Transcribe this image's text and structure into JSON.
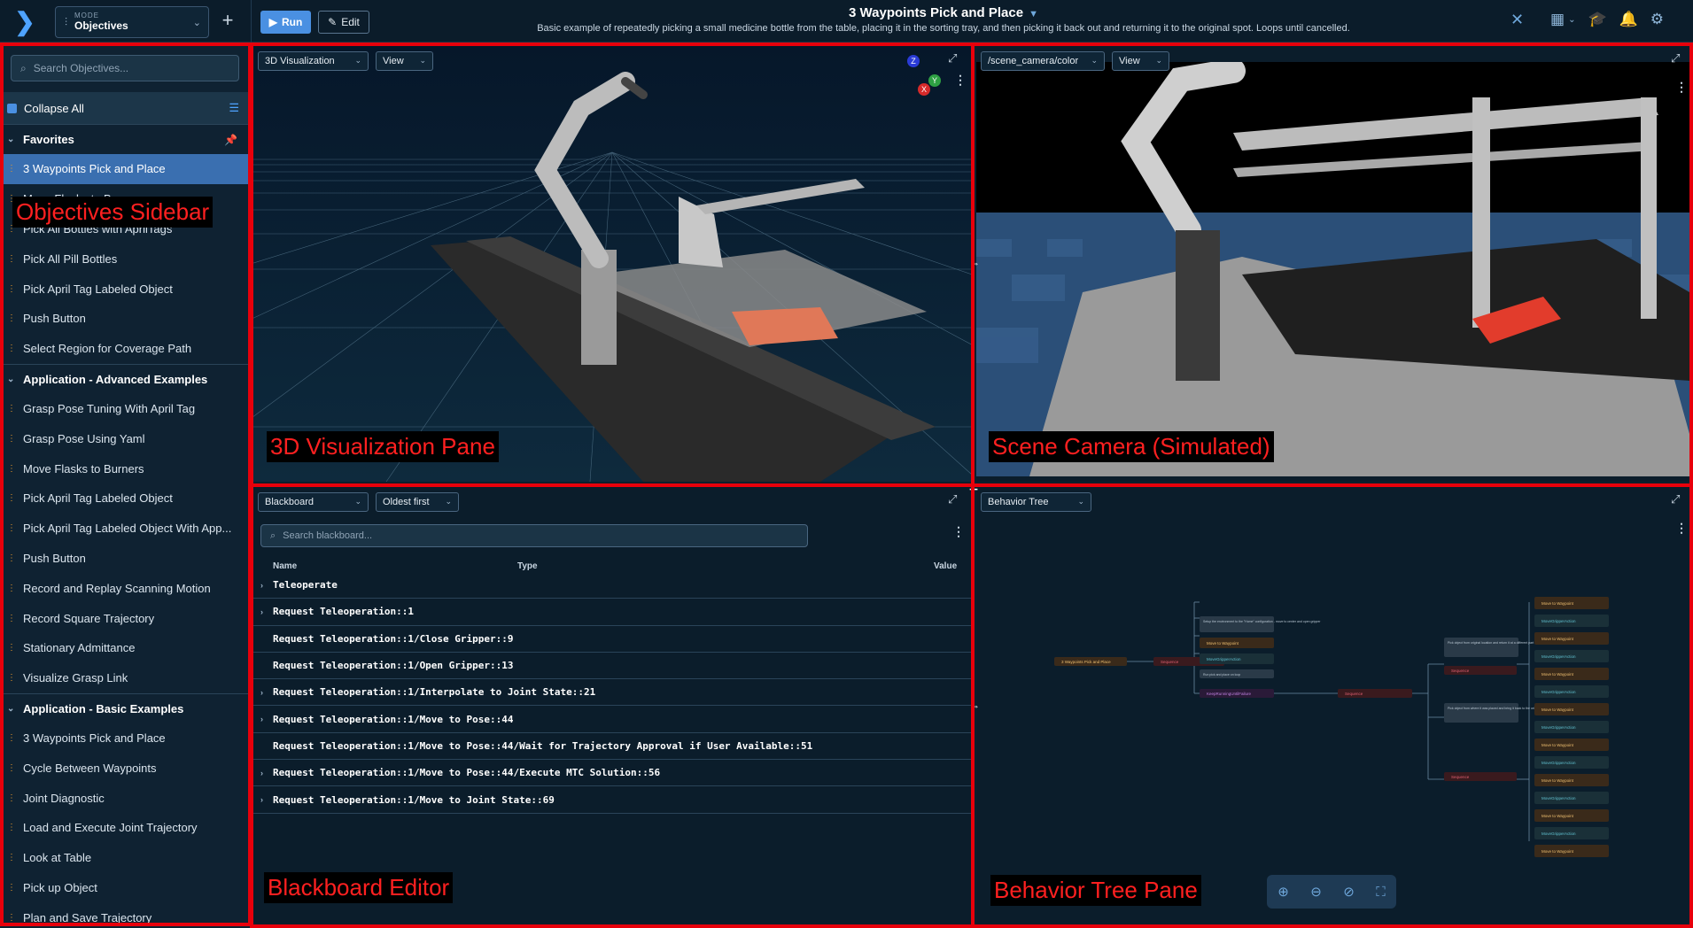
{
  "topbar": {
    "mode_label": "MODE",
    "mode_value": "Objectives",
    "run_label": "Run",
    "edit_label": "Edit",
    "title": "3 Waypoints Pick and Place",
    "subtitle": "Basic example of repeatedly picking a small medicine bottle from the table, placing it in the sorting tray, and then picking it back out and returning it to the original spot. Loops until cancelled."
  },
  "sidebar": {
    "search_placeholder": "Search Objectives...",
    "collapse_label": "Collapse All",
    "favorites": {
      "title": "Favorites",
      "items": [
        "3 Waypoints Pick and Place",
        "Move Flasks to Burners",
        "Pick All Bottles with AprilTags",
        "Pick All Pill Bottles",
        "Pick April Tag Labeled Object",
        "Push Button",
        "Select Region for Coverage Path"
      ]
    },
    "advanced": {
      "title": "Application - Advanced Examples",
      "items": [
        "Grasp Pose Tuning With April Tag",
        "Grasp Pose Using Yaml",
        "Move Flasks to Burners",
        "Pick April Tag Labeled Object",
        "Pick April Tag Labeled Object With App...",
        "Push Button",
        "Record and Replay Scanning Motion",
        "Record Square Trajectory",
        "Stationary Admittance",
        "Visualize Grasp Link"
      ]
    },
    "basic": {
      "title": "Application - Basic Examples",
      "items": [
        "3 Waypoints Pick and Place",
        "Cycle Between Waypoints",
        "Joint Diagnostic",
        "Load and Execute Joint Trajectory",
        "Look at Table",
        "Pick up Object",
        "Plan and Save Trajectory"
      ]
    }
  },
  "viz_pane": {
    "dropdown": "3D Visualization",
    "view": "View",
    "axis_x": "X",
    "axis_y": "Y",
    "axis_z": "Z"
  },
  "camera_pane": {
    "topic": "/scene_camera/color",
    "view": "View"
  },
  "blackboard": {
    "dropdown": "Blackboard",
    "sort": "Oldest first",
    "search_placeholder": "Search blackboard...",
    "col_name": "Name",
    "col_type": "Type",
    "col_value": "Value",
    "rows": [
      {
        "name": "Teleoperate",
        "expandable": true
      },
      {
        "name": "Request Teleoperation::1",
        "expandable": true
      },
      {
        "name": "Request Teleoperation::1/Close Gripper::9",
        "expandable": false
      },
      {
        "name": "Request Teleoperation::1/Open Gripper::13",
        "expandable": false
      },
      {
        "name": "Request Teleoperation::1/Interpolate to Joint State::21",
        "expandable": true
      },
      {
        "name": "Request Teleoperation::1/Move to Pose::44",
        "expandable": true
      },
      {
        "name": "Request Teleoperation::1/Move to Pose::44/Wait for Trajectory Approval if User Available::51",
        "expandable": false
      },
      {
        "name": "Request Teleoperation::1/Move to Pose::44/Execute MTC Solution::56",
        "expandable": true
      },
      {
        "name": "Request Teleoperation::1/Move to Joint State::69",
        "expandable": true
      }
    ]
  },
  "behavior_tree": {
    "dropdown": "Behavior Tree",
    "root_node": "3 Waypoints Pick and Place",
    "sequence_label": "Sequence",
    "keep_running_label": "KeepRunningUntilFailure",
    "move_label": "Move to Waypoint",
    "gripper_label": "MoveGripperAction",
    "comment_1": "Setup the environment to the \"Home\" configuration - move to center and open gripper",
    "comment_2": "Pick object from original location and return it at a different part of the table and go back to center pose",
    "comment_3": "Pick object from where it was placed and bring it back to the original location and go back to center pose",
    "comment_4": "Run pick and place on loop"
  },
  "overlays": {
    "sidebar": "Objectives Sidebar",
    "viz": "3D Visualization Pane",
    "camera": "Scene Camera (Simulated)",
    "blackboard": "Blackboard Editor",
    "bt": "Behavior Tree Pane"
  },
  "colors": {
    "accent": "#4a90e2",
    "annotation_red": "#e8000b",
    "background": "#0b1d2b"
  }
}
